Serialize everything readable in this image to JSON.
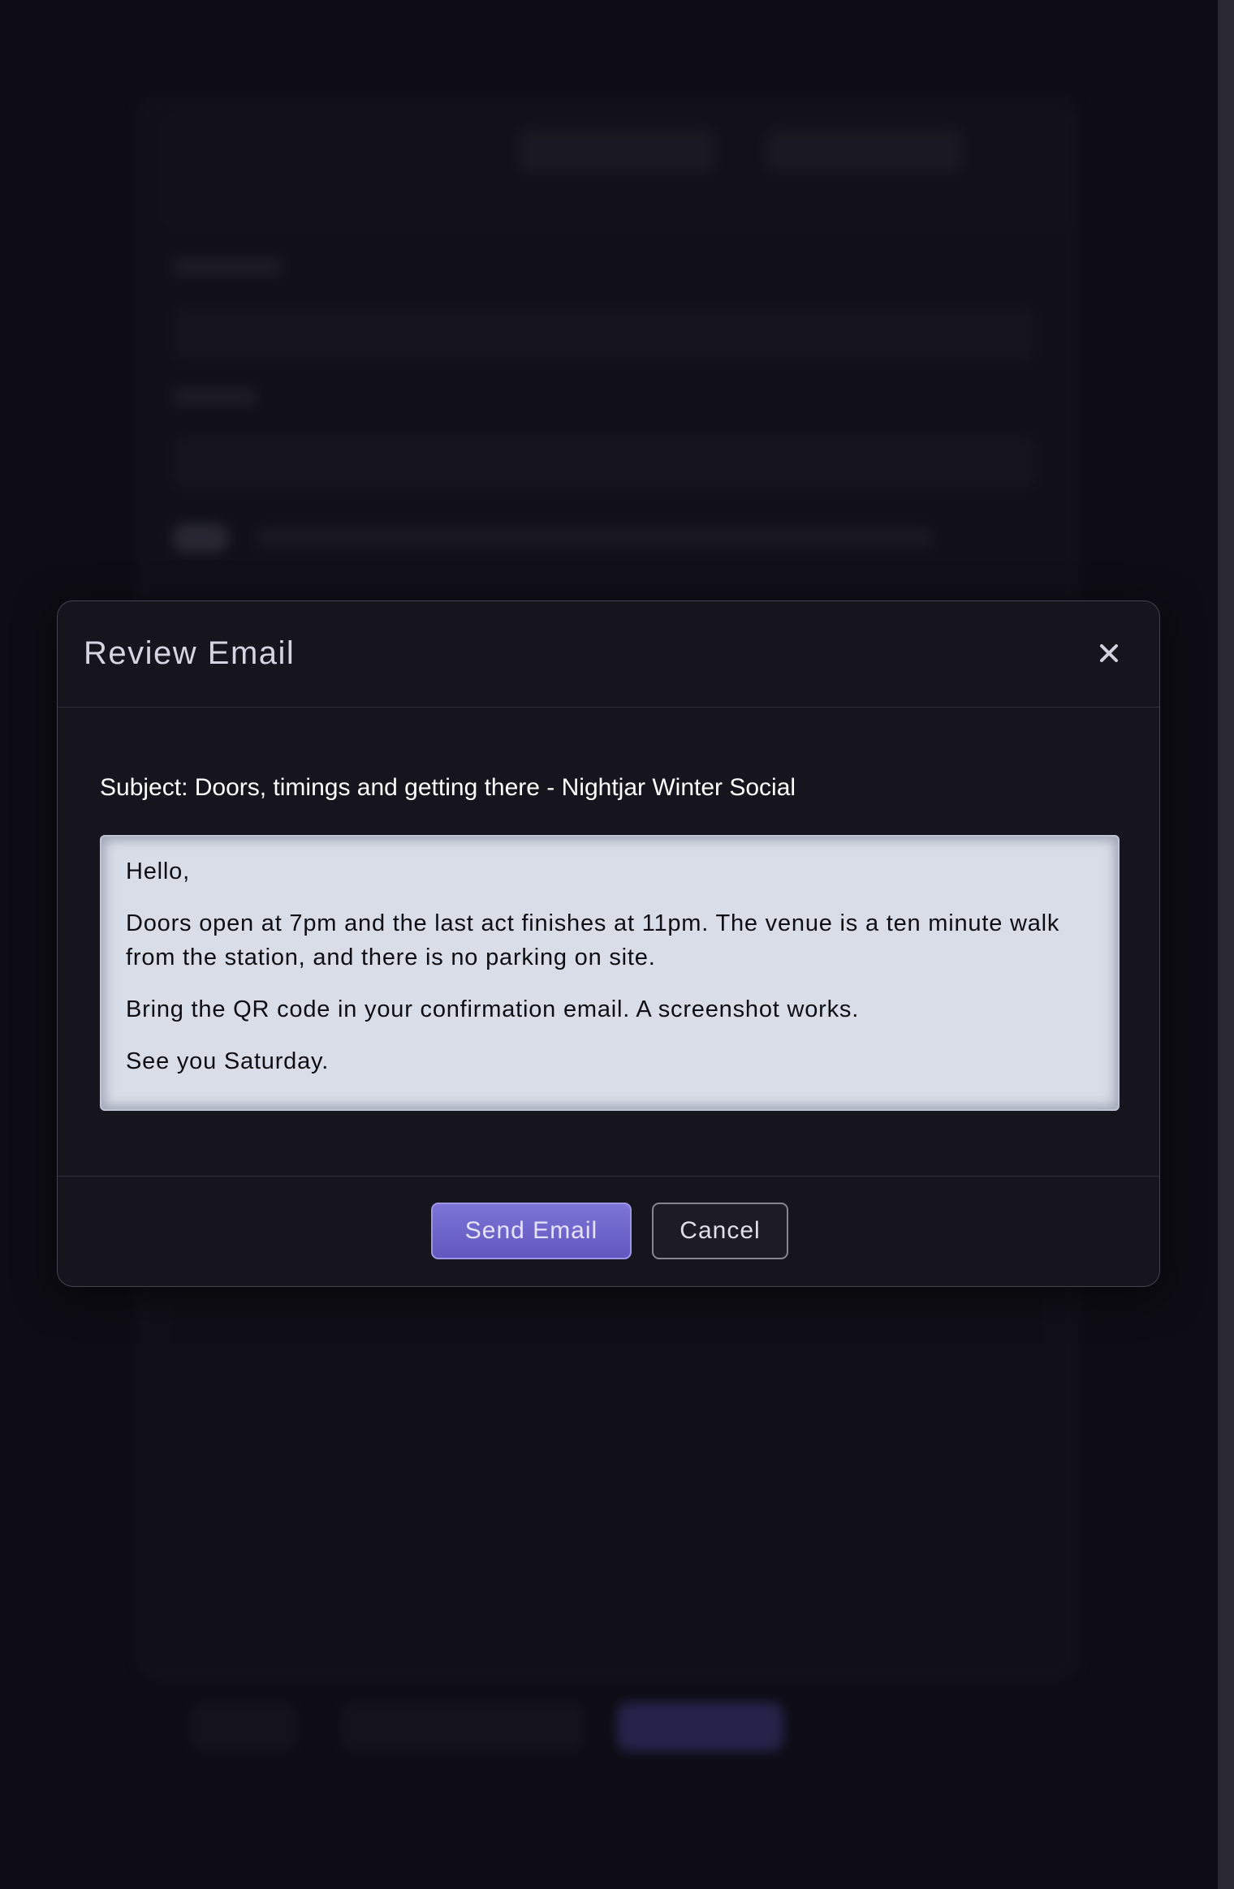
{
  "modal": {
    "title": "Review Email",
    "subject_line": "Subject: Doors, timings and getting there - Nightjar Winter Social",
    "body_paragraphs": [
      "Hello,",
      "Doors open at 7pm and the last act finishes at 11pm. The venue is a ten minute walk from the station, and there is no parking on site.",
      "Bring the QR code in your confirmation email. A screenshot works.",
      "See you Saturday."
    ],
    "send_label": "Send Email",
    "cancel_label": "Cancel",
    "close_icon": "close-icon"
  },
  "colors": {
    "backdrop": "#0e0d15",
    "modal_bg": "#16151e",
    "accent": "#6c62cc",
    "body_bg": "#d9dde7"
  }
}
